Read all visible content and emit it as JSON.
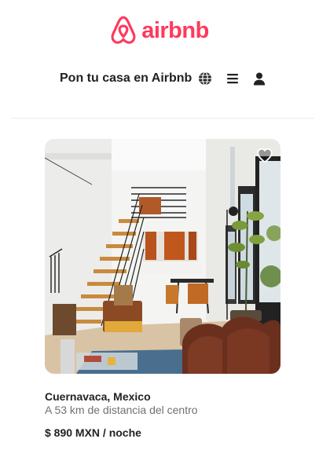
{
  "brand": {
    "name": "airbnb",
    "color": "#FF385C"
  },
  "nav": {
    "host_link": "Pon tu casa en Airbnb",
    "icons": [
      "globe-icon",
      "menu-icon",
      "user-icon"
    ]
  },
  "listing": {
    "location": "Cuernavaca, Mexico",
    "distance": "A 53 km de distancia del centro",
    "price": "$ 890 MXN / noche",
    "favorite_icon": "heart-outline-icon"
  }
}
